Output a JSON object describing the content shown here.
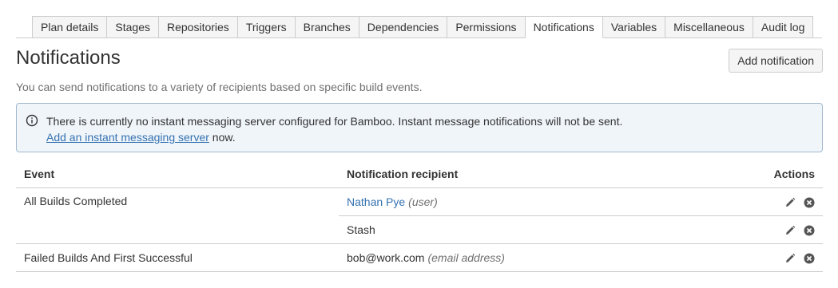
{
  "tabs": [
    {
      "label": "Plan details",
      "active": false
    },
    {
      "label": "Stages",
      "active": false
    },
    {
      "label": "Repositories",
      "active": false
    },
    {
      "label": "Triggers",
      "active": false
    },
    {
      "label": "Branches",
      "active": false
    },
    {
      "label": "Dependencies",
      "active": false
    },
    {
      "label": "Permissions",
      "active": false
    },
    {
      "label": "Notifications",
      "active": true
    },
    {
      "label": "Variables",
      "active": false
    },
    {
      "label": "Miscellaneous",
      "active": false
    },
    {
      "label": "Audit log",
      "active": false
    }
  ],
  "header": {
    "title": "Notifications",
    "add_button_label": "Add notification"
  },
  "description": "You can send notifications to a variety of recipients based on specific build events.",
  "info_message": {
    "icon": "info-icon",
    "text": "There is currently no instant messaging server configured for Bamboo. Instant message notifications will not be sent.",
    "link_text": "Add an instant messaging server",
    "link_suffix": " now."
  },
  "table": {
    "headers": {
      "event": "Event",
      "recipient": "Notification recipient",
      "actions": "Actions"
    },
    "rows": [
      {
        "event": "All Builds Completed",
        "recipient": "Nathan Pye",
        "recipient_type": "(user)"
      },
      {
        "event": "",
        "recipient": "Stash",
        "recipient_type": ""
      },
      {
        "event": "Failed Builds And First Successful",
        "recipient": "bob@work.com",
        "recipient_type": "(email address)"
      }
    ],
    "action_icons": [
      "edit-icon",
      "delete-icon"
    ]
  },
  "colors": {
    "link": "#3572b0",
    "info_border": "#a2b9cd",
    "info_background": "#f0f5fa",
    "border": "#cccccc",
    "muted_text": "#707070"
  }
}
